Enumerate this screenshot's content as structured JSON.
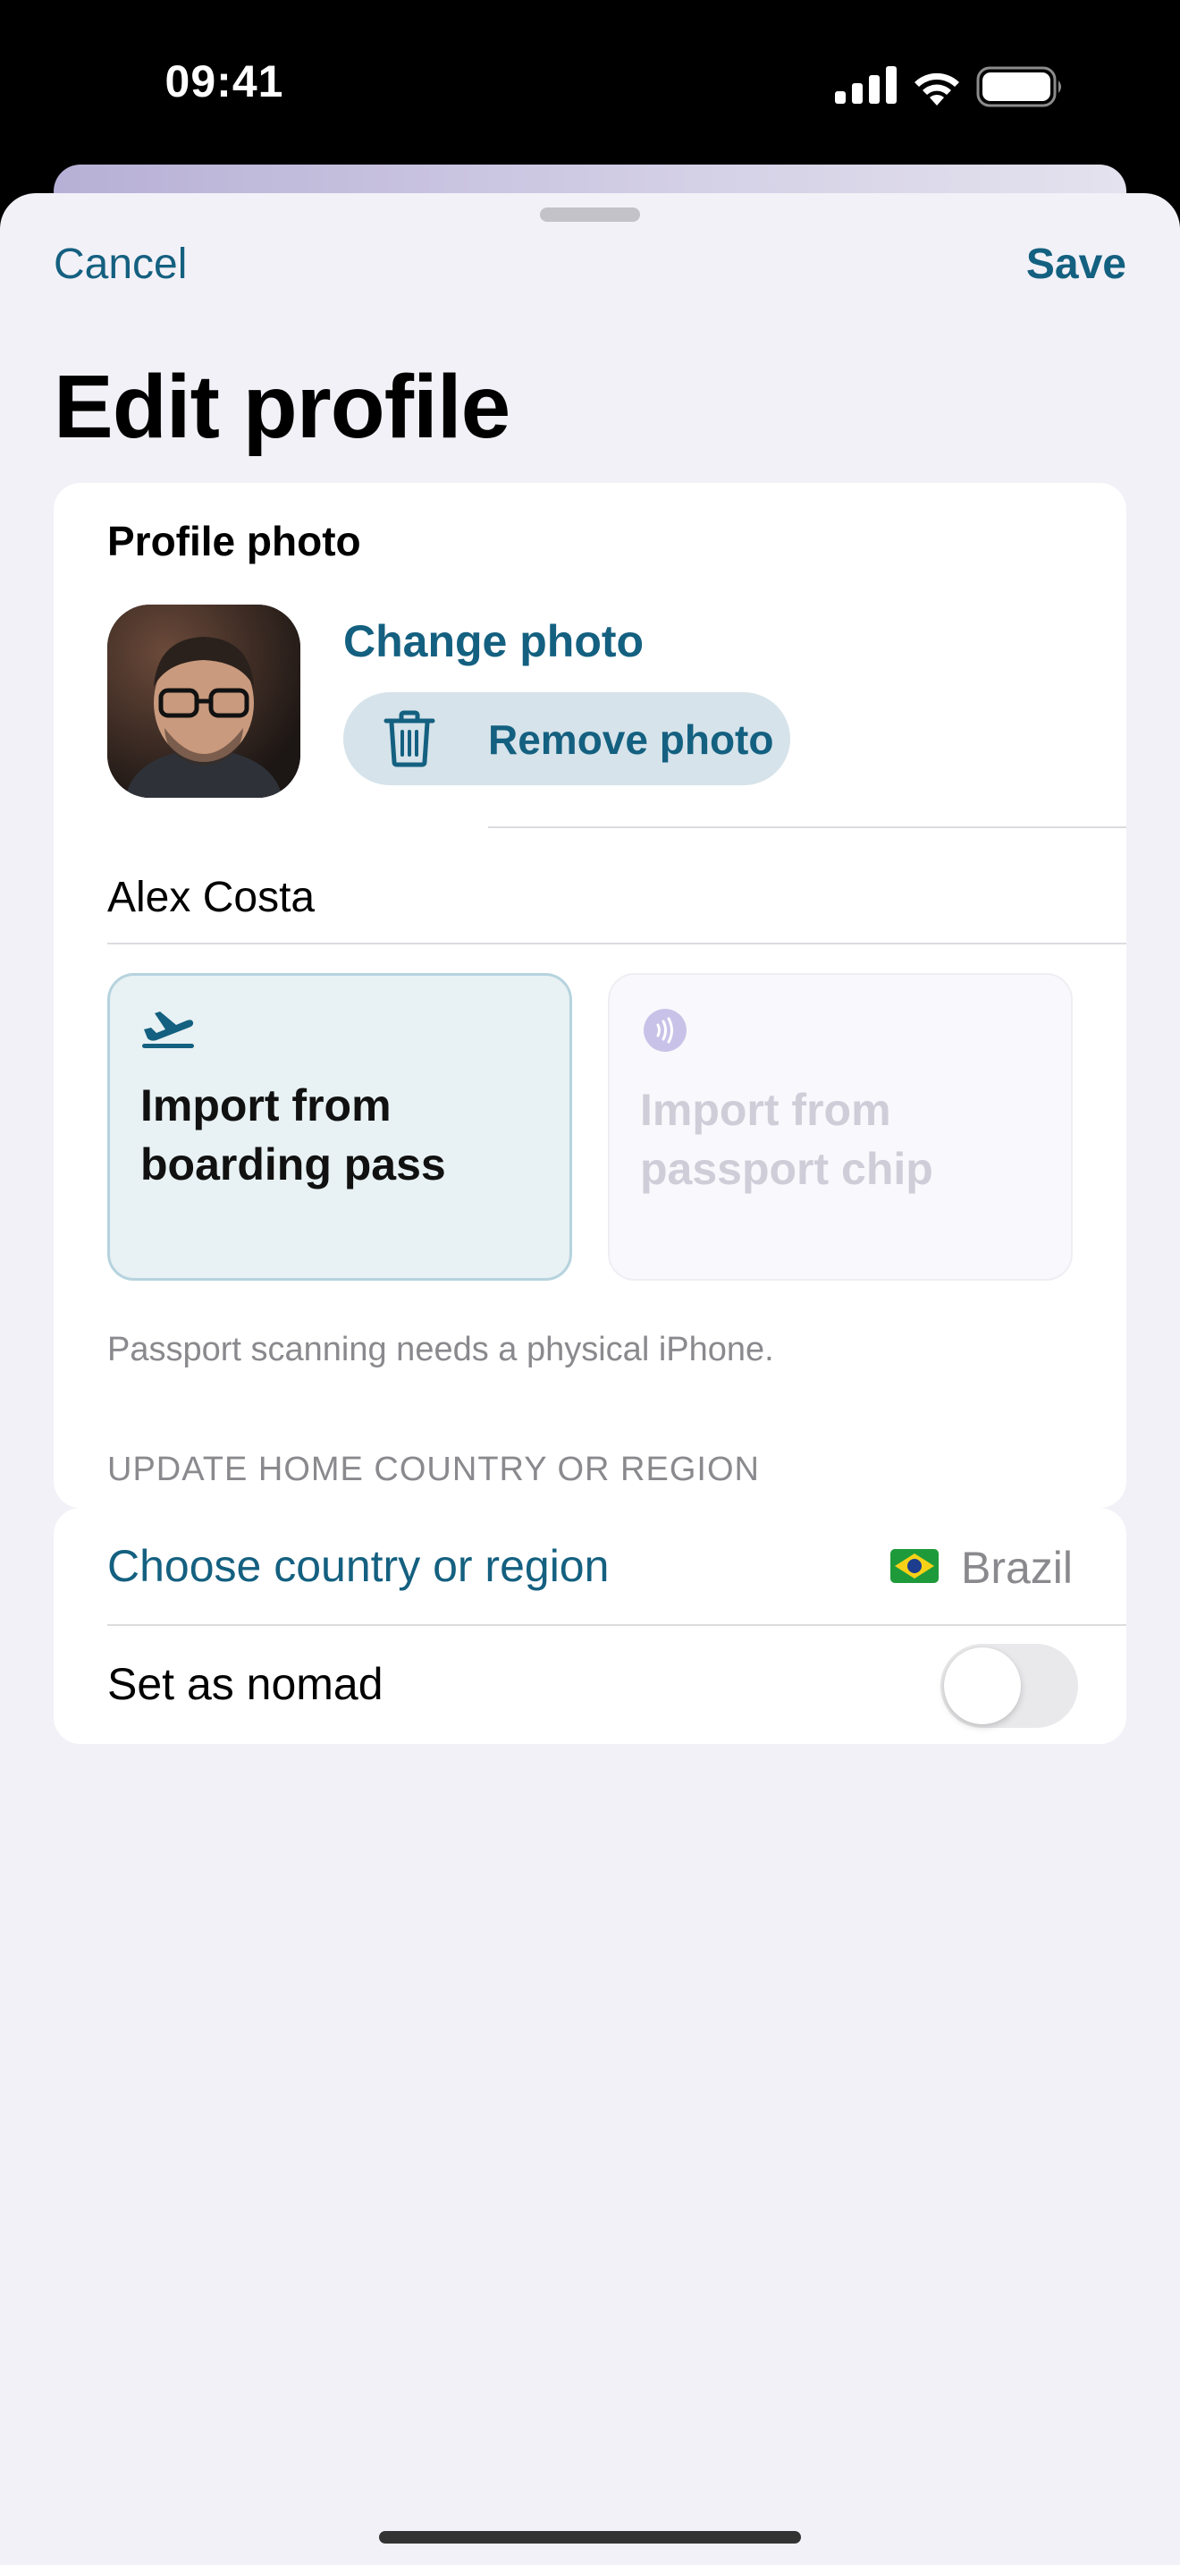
{
  "status_bar": {
    "time": "09:41",
    "icons": [
      "cellular-signal-icon",
      "wifi-icon",
      "battery-icon"
    ]
  },
  "nav": {
    "cancel_label": "Cancel",
    "save_label": "Save"
  },
  "title": "Edit profile",
  "profile_photo": {
    "section_label": "Profile photo",
    "change_label": "Change photo",
    "remove_label": "Remove photo"
  },
  "name": {
    "value": "Alex Costa"
  },
  "imports": {
    "boarding_pass": {
      "label_line1": "Import from",
      "label_line2": "boarding pass",
      "icon": "airplane-departure-icon",
      "enabled": true
    },
    "passport_chip": {
      "label_line1": "Import from",
      "label_line2": "passport chip",
      "icon": "nfc-icon",
      "enabled": false
    }
  },
  "footnote": "Passport scanning needs a physical iPhone.",
  "home_country": {
    "group_header": "UPDATE HOME COUNTRY OR REGION",
    "choose_label": "Choose country or region",
    "selected_country": "Brazil",
    "flag_icon": "brazil-flag-icon",
    "nomad_label": "Set as nomad",
    "nomad_enabled": false
  },
  "colors": {
    "accent": "#146080",
    "sheet_background": "#f2f1f7",
    "card_background": "#ffffff",
    "secondary_text": "#8a8a8e"
  }
}
